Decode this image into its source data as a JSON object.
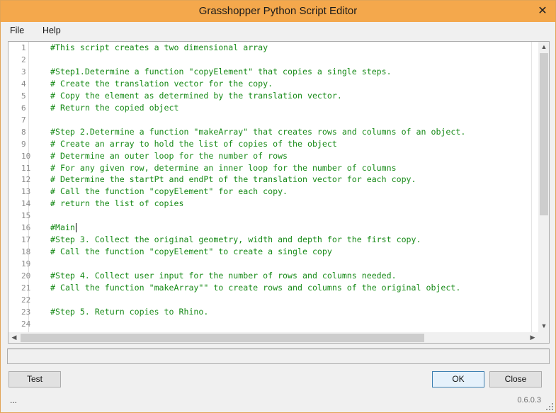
{
  "window": {
    "title": "Grasshopper Python Script Editor"
  },
  "menu": {
    "file": "File",
    "help": "Help"
  },
  "editor": {
    "line_numbers": [
      "1",
      "2",
      "3",
      "4",
      "5",
      "6",
      "7",
      "8",
      "9",
      "10",
      "11",
      "12",
      "13",
      "14",
      "15",
      "16",
      "17",
      "18",
      "19",
      "20",
      "21",
      "22",
      "23",
      "24"
    ],
    "lines": [
      "#This script creates a two dimensional array",
      "",
      "#Step1.Determine a function \"copyElement\" that copies a single steps.",
      "# Create the translation vector for the copy.",
      "# Copy the element as determined by the translation vector.",
      "# Return the copied object",
      "",
      "#Step 2.Determine a function \"makeArray\" that creates rows and columns of an object.",
      "# Create an array to hold the list of copies of the object",
      "# Determine an outer loop for the number of rows",
      "# For any given row, determine an inner loop for the number of columns",
      "# Determine the startPt and endPt of the translation vector for each copy.",
      "# Call the function \"copyElement\" for each copy.",
      "# return the list of copies",
      "",
      "#Main",
      "#Step 3. Collect the original geometry, width and depth for the first copy.",
      "# Call the function \"copyElement\" to create a single copy",
      "",
      "#Step 4. Collect user input for the number of rows and columns needed.",
      "# Call the function \"makeArray\"\" to create rows and columns of the original object.",
      "",
      "#Step 5. Return copies to Rhino.",
      ""
    ],
    "colors": {
      "code": "#178a17",
      "line_number": "#8a8a8a"
    }
  },
  "status_text": "",
  "buttons": {
    "test": "Test",
    "ok": "OK",
    "close": "Close"
  },
  "footer": {
    "ellipsis": "...",
    "version": "0.6.0.3"
  },
  "icons": {
    "close": "close-icon",
    "grip": "resize-grip-icon"
  }
}
